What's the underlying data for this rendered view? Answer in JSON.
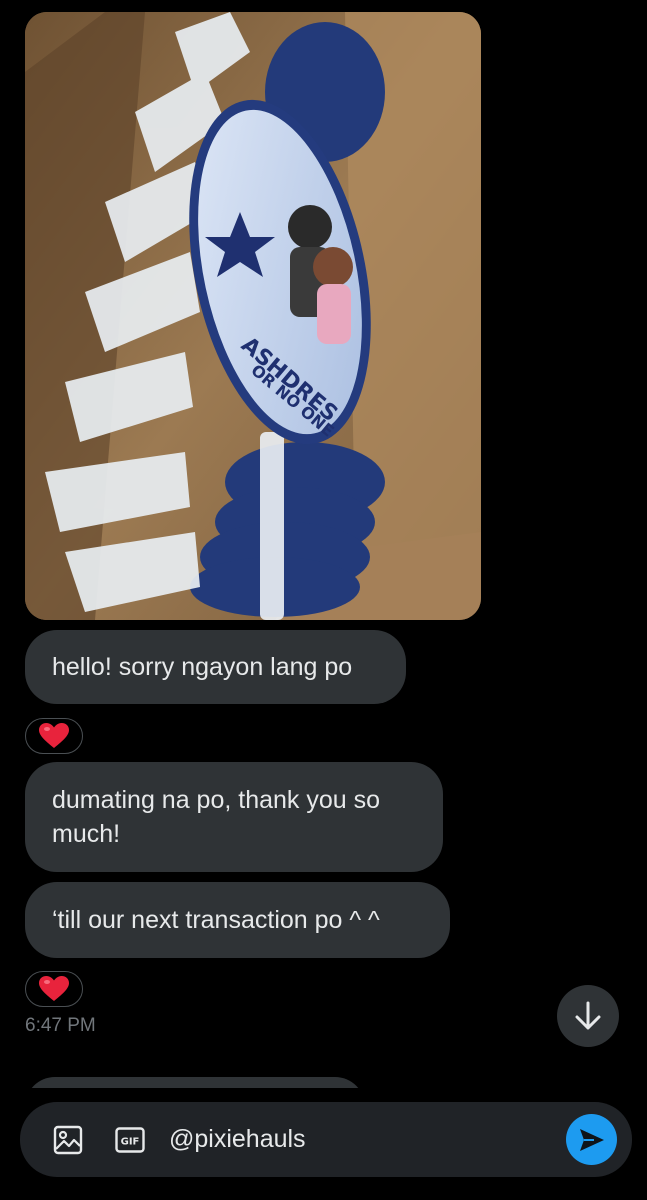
{
  "conversation": {
    "messages": [
      {
        "text": "hello! sorry ngayon lang po"
      },
      {
        "text": "dumating na po, thank you so much!"
      },
      {
        "text": "‘till our next transaction po ^ ^"
      }
    ],
    "reaction": "❤️",
    "timestamp": "6:47 PM"
  },
  "photo": {
    "fan_text_line1": "ASHDRES",
    "fan_text_line2": "OR NO ONE"
  },
  "composer": {
    "value": "@pixiehauls",
    "gif_label": "GIF"
  },
  "icons": {
    "image": "image-icon",
    "gif": "gif-icon",
    "send": "send-icon",
    "scroll_down": "arrow-down-icon"
  },
  "colors": {
    "background": "#000000",
    "bubble": "#2f3336",
    "composer": "#202327",
    "accent": "#1d9bf0",
    "muted_text": "#71767b"
  }
}
